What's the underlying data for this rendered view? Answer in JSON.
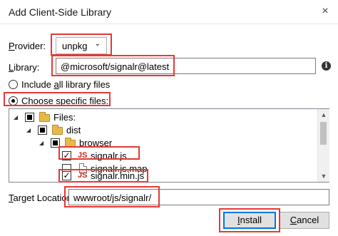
{
  "window": {
    "title": "Add Client-Side Library",
    "close_glyph": "×"
  },
  "provider": {
    "label_pre": "",
    "label_ul": "P",
    "label_post": "rovider:",
    "value": "unpkg"
  },
  "library": {
    "label_pre": "",
    "label_ul": "L",
    "label_post": "ibrary:",
    "value": "@microsoft/signalr@latest",
    "info_glyph": "i"
  },
  "options": {
    "include_all": {
      "pre": "Include ",
      "ul": "a",
      "post": "ll library files",
      "selected": false
    },
    "choose_specific": {
      "pre": "Choose ",
      "ul": "s",
      "post": "pecific files:",
      "selected": true
    }
  },
  "tree": {
    "nodes": [
      {
        "label": "Files:",
        "state": "partial",
        "kind": "folder"
      },
      {
        "label": "dist",
        "state": "partial",
        "kind": "folder"
      },
      {
        "label": "browser",
        "state": "partial",
        "kind": "folder"
      },
      {
        "label": "signalr.js",
        "state": "checked",
        "kind": "js",
        "icon_text": "JS"
      },
      {
        "label": "signalr.js.map",
        "state": "unchecked",
        "kind": "file"
      },
      {
        "label": "signalr.min.js",
        "state": "checked",
        "kind": "js",
        "icon_text": "JS"
      }
    ],
    "check_glyph": "✓"
  },
  "target": {
    "label_pre": "",
    "label_ul": "T",
    "label_post": "arget Location:",
    "value": "wwwroot/js/signalr/"
  },
  "buttons": {
    "install": {
      "pre": "",
      "ul": "I",
      "post": "nstall"
    },
    "cancel": {
      "pre": "",
      "ul": "C",
      "post": "ancel"
    }
  },
  "colors": {
    "highlight": "#e53935",
    "default_button_border": "#0078d7",
    "folder": "#e8b94a",
    "js_icon": "#c42b1c"
  }
}
